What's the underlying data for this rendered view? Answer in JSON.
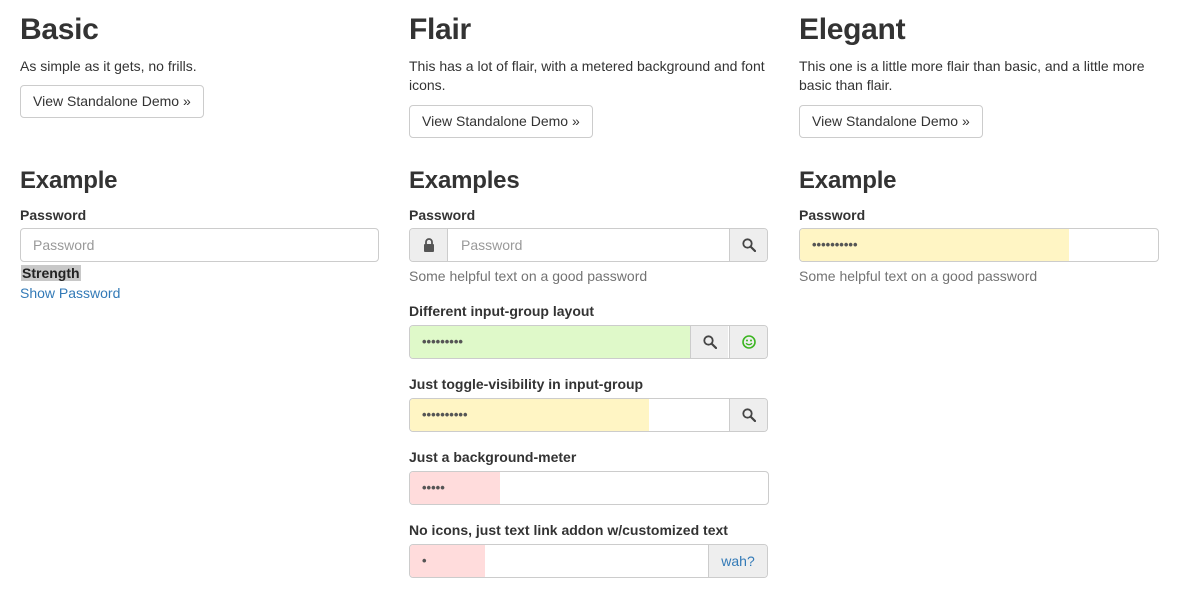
{
  "basic": {
    "title": "Basic",
    "description": "As simple as it gets, no frills.",
    "demo_button": "View Standalone Demo »",
    "example_heading": "Example",
    "password_label": "Password",
    "password_placeholder": "Password",
    "strength_label": "Strength",
    "show_password_link": "Show Password"
  },
  "flair": {
    "title": "Flair",
    "description": "This has a lot of flair, with a metered background and font icons.",
    "demo_button": "View Standalone Demo »",
    "example_heading": "Examples",
    "password_label": "Password",
    "password_placeholder": "Password",
    "help_text": "Some helpful text on a good password",
    "layout_label": "Different input-group layout",
    "layout_value": "•••••••••",
    "layout_meter": {
      "fraction": 1.0,
      "color": "#dff9c9"
    },
    "toggle_label": "Just toggle-visibility in input-group",
    "toggle_value": "••••••••••",
    "toggle_meter": {
      "fraction": 0.75,
      "color": "#fff5c4"
    },
    "bg_meter_label": "Just a background-meter",
    "bg_meter_value": "•••••",
    "bg_meter": {
      "fraction": 0.25,
      "color": "#ffdcdc"
    },
    "text_link_label": "No icons, just text link addon w/customized text",
    "text_link_value": "•",
    "text_link_meter": {
      "fraction": 0.25,
      "color": "#ffdcdc"
    },
    "text_link_addon": "wah?",
    "icons": [
      "lock-icon",
      "search-icon",
      "smiley-icon"
    ]
  },
  "elegant": {
    "title": "Elegant",
    "description": "This one is a little more flair than basic, and a little more basic than flair.",
    "demo_button": "View Standalone Demo »",
    "example_heading": "Example",
    "password_label": "Password",
    "password_value": "••••••••••",
    "meter": {
      "fraction": 0.75,
      "color": "#fff5c4"
    },
    "help_text": "Some helpful text on a good password"
  },
  "colors": {
    "link": "#337ab7",
    "border": "#cccccc",
    "addon_bg": "#eeeeee",
    "help": "#737373",
    "smiley": "#3cb521"
  }
}
